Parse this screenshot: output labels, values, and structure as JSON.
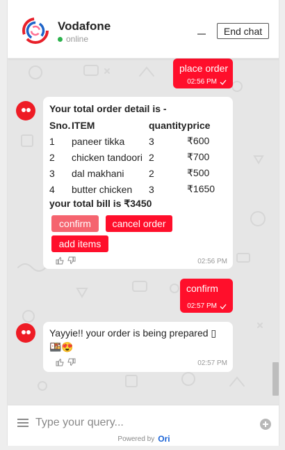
{
  "header": {
    "brand_name": "Vodafone",
    "status": "online",
    "end_chat_label": "End chat"
  },
  "messages": {
    "user1": {
      "text": "place order",
      "time": "02:56 PM"
    },
    "order": {
      "title": "Your total order detail is -",
      "columns": [
        "Sno.",
        "ITEM",
        "quantity",
        "price"
      ],
      "rows": [
        [
          "1",
          "paneer tikka",
          "3",
          "₹600"
        ],
        [
          "2",
          "chicken tandoori",
          "2",
          "₹700"
        ],
        [
          "3",
          "dal makhani",
          "2",
          "₹500"
        ],
        [
          "4",
          "butter chicken",
          "3",
          "₹1650"
        ]
      ],
      "total": "your total bill is ₹3450",
      "buttons": [
        "confirm",
        "cancel order",
        "add items"
      ],
      "time": "02:56 PM"
    },
    "user2": {
      "text": "confirm",
      "time": "02:57 PM"
    },
    "bot2": {
      "text": "Yayyie!! your order is being prepared ▯",
      "emojis": "🍱😍",
      "time": "02:57 PM"
    }
  },
  "footer": {
    "placeholder": "Type your query...",
    "powered_by": "Powered by",
    "brand": "Ori"
  },
  "colors": {
    "accent": "#ff0f2b",
    "accent_light": "#f5646f",
    "bot_avatar": "#ee1c25",
    "online": "#2bb24c",
    "ori_blue": "#1a63d6"
  },
  "icons": [
    "vodafone-logo",
    "minimize-icon",
    "check-icon",
    "bot-avatar",
    "thumbs-up-icon",
    "thumbs-down-icon",
    "menu-icon",
    "plus-icon"
  ]
}
